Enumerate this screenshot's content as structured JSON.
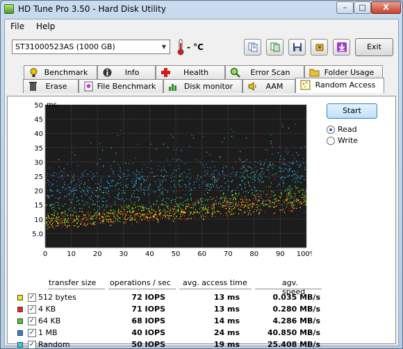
{
  "window": {
    "title": "HD Tune Pro 3.50 - Hard Disk Utility",
    "min_label": "–",
    "max_label": "□",
    "close_label": "X"
  },
  "menu": [
    {
      "label": "File"
    },
    {
      "label": "Help"
    }
  ],
  "toolbar": {
    "drive": "ST31000523AS (1000 GB)",
    "temperature": "- °C",
    "exit_label": "Exit"
  },
  "tabs_row1": [
    {
      "label": "Benchmark",
      "icon": "benchmark-icon"
    },
    {
      "label": "Info",
      "icon": "info-icon"
    },
    {
      "label": "Health",
      "icon": "health-icon"
    },
    {
      "label": "Error Scan",
      "icon": "error-scan-icon"
    },
    {
      "label": "Folder Usage",
      "icon": "folder-icon"
    }
  ],
  "tabs_row2": [
    {
      "label": "Erase",
      "icon": "erase-icon"
    },
    {
      "label": "File Benchmark",
      "icon": "file-benchmark-icon"
    },
    {
      "label": "Disk monitor",
      "icon": "disk-monitor-icon"
    },
    {
      "label": "AAM",
      "icon": "speaker-icon"
    },
    {
      "label": "Random Access",
      "icon": "random-access-icon",
      "active": true
    }
  ],
  "controls": {
    "start_label": "Start",
    "read_label": "Read",
    "write_label": "Write",
    "mode": "Read"
  },
  "chart_data": {
    "type": "scatter",
    "ylabel": "ms",
    "ylim": [
      0,
      50
    ],
    "xlim": [
      0,
      100
    ],
    "y_ticks": [
      "50",
      "45",
      "40",
      "35",
      "30",
      "25",
      "20",
      "15",
      "10",
      "5.0"
    ],
    "y_tick_values": [
      50,
      45,
      40,
      35,
      30,
      25,
      20,
      15,
      10,
      5
    ],
    "x_ticks": [
      "0",
      "10",
      "20",
      "30",
      "40",
      "50",
      "60",
      "70",
      "80",
      "90",
      "100%"
    ],
    "x_tick_values": [
      0,
      10,
      20,
      30,
      40,
      50,
      60,
      70,
      80,
      90,
      100
    ],
    "grid": true,
    "background": "#1c1c1c",
    "series": [
      {
        "name": "512 bytes",
        "color": "#f6e81a",
        "band": [
          [
            0,
            6,
            12
          ],
          [
            50,
            9,
            16
          ],
          [
            100,
            12,
            21
          ]
        ]
      },
      {
        "name": "4 KB",
        "color": "#e8231b",
        "band": [
          [
            0,
            6,
            12
          ],
          [
            50,
            9,
            17
          ],
          [
            100,
            12,
            22
          ]
        ]
      },
      {
        "name": "64 KB",
        "color": "#3fcf2a",
        "band": [
          [
            0,
            6,
            14
          ],
          [
            50,
            10,
            18
          ],
          [
            100,
            14,
            24
          ]
        ]
      },
      {
        "name": "1 MB",
        "color": "#2f7fd6",
        "band": [
          [
            0,
            15,
            30
          ],
          [
            50,
            17,
            33
          ],
          [
            100,
            20,
            38
          ]
        ]
      },
      {
        "name": "Random",
        "color": "#29d2dd",
        "band": [
          [
            0,
            11,
            26
          ],
          [
            50,
            13,
            29
          ],
          [
            100,
            15,
            36
          ]
        ]
      }
    ]
  },
  "results": {
    "headers": [
      "transfer size",
      "operations / sec",
      "avg. access time",
      "agv. speed"
    ],
    "rows": [
      {
        "name": "512 bytes",
        "color": "#f6e81a",
        "ops": "72 IOPS",
        "access": "13 ms",
        "speed": "0.035 MB/s"
      },
      {
        "name": "4 KB",
        "color": "#e8231b",
        "ops": "71 IOPS",
        "access": "13 ms",
        "speed": "0.280 MB/s"
      },
      {
        "name": "64 KB",
        "color": "#3fcf2a",
        "ops": "68 IOPS",
        "access": "14 ms",
        "speed": "4.286 MB/s"
      },
      {
        "name": "1 MB",
        "color": "#2f7fd6",
        "ops": "40 IOPS",
        "access": "24 ms",
        "speed": "40.850 MB/s"
      },
      {
        "name": "Random",
        "color": "#29d2dd",
        "ops": "50 IOPS",
        "access": "19 ms",
        "speed": "25.408 MB/s"
      }
    ]
  }
}
